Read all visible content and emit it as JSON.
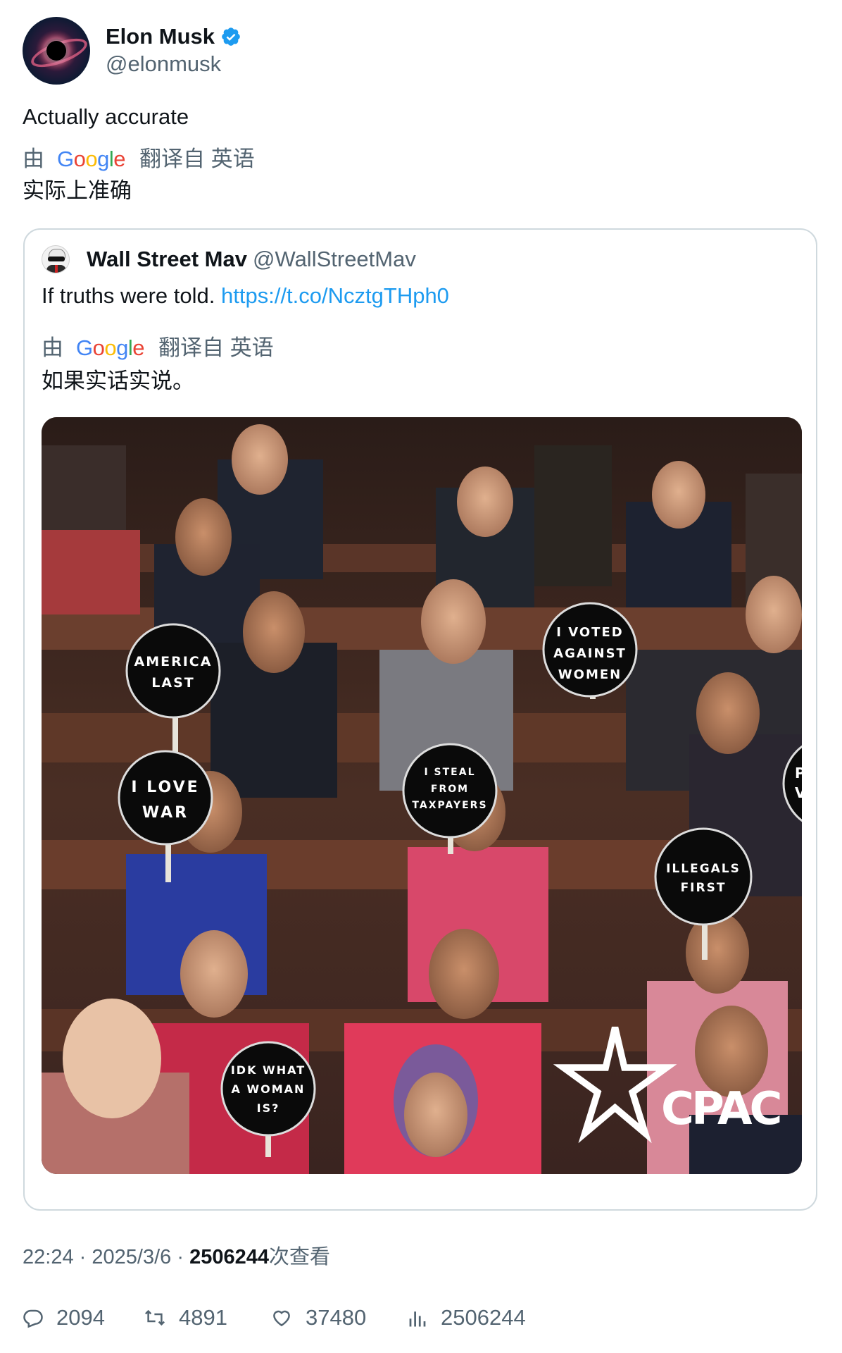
{
  "tweet": {
    "author_name": "Elon Musk",
    "author_handle": "@elonmusk",
    "text": "Actually accurate",
    "translate": {
      "by": "由",
      "google_letters": [
        "G",
        "o",
        "o",
        "g",
        "l",
        "e"
      ],
      "translated_from": "翻译自 英语",
      "translated_text": "实际上准确"
    }
  },
  "quote": {
    "author_name": "Wall Street Mav",
    "author_handle": "@WallStreetMav",
    "text": "If truths were told.",
    "link": "https://t.co/NcztgTHph0",
    "translate": {
      "by": "由",
      "google_letters": [
        "G",
        "o",
        "o",
        "g",
        "l",
        "e"
      ],
      "translated_from": "翻译自 英语",
      "translated_text": "如果实话实说。"
    },
    "image": {
      "signs": [
        {
          "lines": [
            "AMERICA",
            "LAST"
          ]
        },
        {
          "lines": [
            "I VOTED",
            "AGAINST",
            "WOMEN"
          ]
        },
        {
          "lines": [
            "I LOVE",
            "WAR"
          ]
        },
        {
          "lines": [
            "I STEAL",
            "FROM",
            "TAXPAYERS"
          ]
        },
        {
          "lines": [
            "ILLEGALS",
            "FIRST"
          ]
        },
        {
          "lines": [
            "IDK WHAT",
            "A WOMAN",
            "IS?"
          ]
        },
        {
          "lines": [
            "PF",
            "VE"
          ]
        }
      ],
      "watermark": "CPAC"
    }
  },
  "meta": {
    "time": "22:24",
    "separator": "·",
    "date": "2025/3/6",
    "views_count": "2506244",
    "views_label": "次查看"
  },
  "actions": {
    "replies": "2094",
    "retweets": "4891",
    "likes": "37480",
    "views": "2506244"
  },
  "colors": {
    "link": "#1d9bf0",
    "verified": "#1d9bf0",
    "muted": "#536471",
    "border": "#cfd9de"
  }
}
